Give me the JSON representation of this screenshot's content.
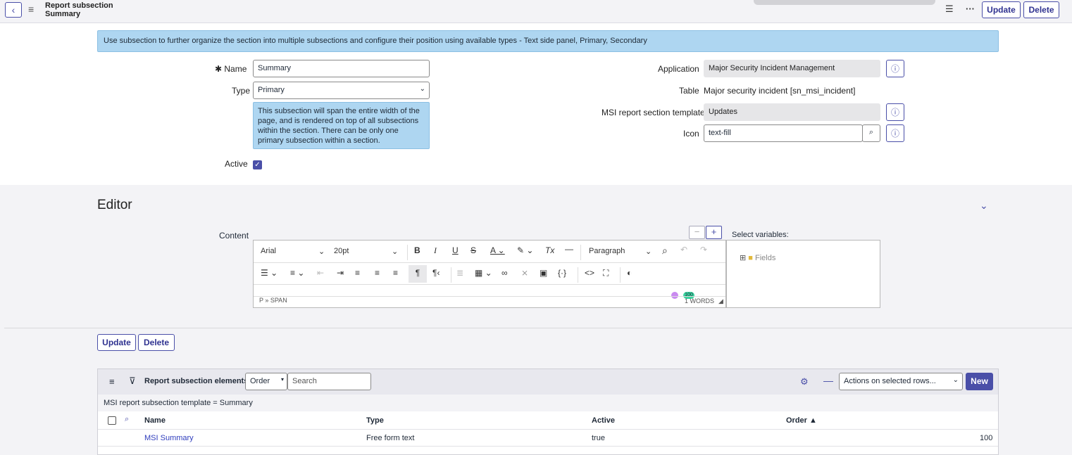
{
  "header": {
    "title_line1": "Report subsection",
    "title_line2": "Summary",
    "update_label": "Update",
    "delete_label": "Delete",
    "settings_icon": "sliders-icon",
    "more_icon": "more-icon"
  },
  "banner": "Use subsection to further organize the section into multiple subsections and configure their position using available types - Text side panel, Primary, Secondary",
  "form": {
    "name_label": "Name",
    "name_value": "Summary",
    "type_label": "Type",
    "type_value": "Primary",
    "type_hint": "This subsection will span the entire width of the page, and is rendered on top of all subsections within the section. There can be only one primary subsection within a section.",
    "active_label": "Active",
    "active_checked": true,
    "application_label": "Application",
    "application_value": "Major Security Incident Management",
    "table_label": "Table",
    "table_value": "Major security incident [sn_msi_incident]",
    "template_label": "MSI report section template",
    "template_value": "Updates",
    "icon_label": "Icon",
    "icon_value": "text-fill"
  },
  "editor": {
    "section_title": "Editor",
    "content_label": "Content",
    "font_family": "Arial",
    "font_size": "20pt",
    "block_format": "Paragraph",
    "path": "P » SPAN",
    "word_count": "1 WORDS",
    "badge": "100",
    "vars_label": "Select variables:",
    "fields_label": "Fields"
  },
  "actions": {
    "update_label": "Update",
    "delete_label": "Delete"
  },
  "related_list": {
    "title": "Report subsection elements",
    "order_select": "Order",
    "search_placeholder": "Search",
    "actions_select": "Actions on selected rows...",
    "new_label": "New",
    "filter": "MSI report subsection template = Summary",
    "columns": [
      "Name",
      "Type",
      "Active",
      "Order ▲"
    ],
    "rows": [
      {
        "name": "MSI Summary",
        "type": "Free form text",
        "active": "true",
        "order": "100"
      }
    ]
  },
  "colors": {
    "accent": "#4a4fa8",
    "banner": "#aed6f1",
    "link": "#2f3dbd"
  }
}
